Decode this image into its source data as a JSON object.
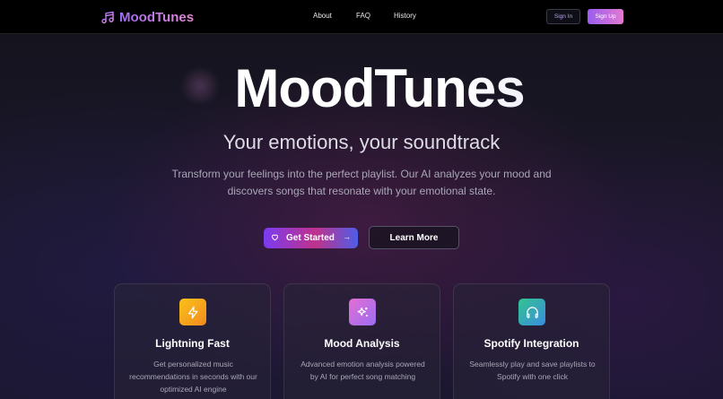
{
  "nav": {
    "brand": "MoodTunes",
    "links": [
      "About",
      "FAQ",
      "History"
    ],
    "sign_in": "Sign In",
    "sign_up": "Sign Up"
  },
  "hero": {
    "title": "MoodTunes",
    "subtitle": "Your emotions, your soundtrack",
    "description": "Transform your feelings into the perfect playlist. Our AI analyzes your mood and discovers songs that resonate with your emotional state.",
    "primary_cta": "Get Started",
    "secondary_cta": "Learn More"
  },
  "features": [
    {
      "icon": "lightning-icon",
      "title": "Lightning Fast",
      "description": "Get personalized music recommendations in seconds with our optimized AI engine",
      "color": "#f7a21b"
    },
    {
      "icon": "sparkles-icon",
      "title": "Mood Analysis",
      "description": "Advanced emotion analysis powered by AI for perfect song matching",
      "color": "#c26ce8"
    },
    {
      "icon": "headphones-icon",
      "title": "Spotify Integration",
      "description": "Seamlessly play and save playlists to Spotify with one click",
      "color": "#2fb39a"
    }
  ],
  "colors": {
    "accent_purple": "#9a5cf0",
    "accent_pink": "#e27ad0",
    "background": "#0d0c16"
  }
}
